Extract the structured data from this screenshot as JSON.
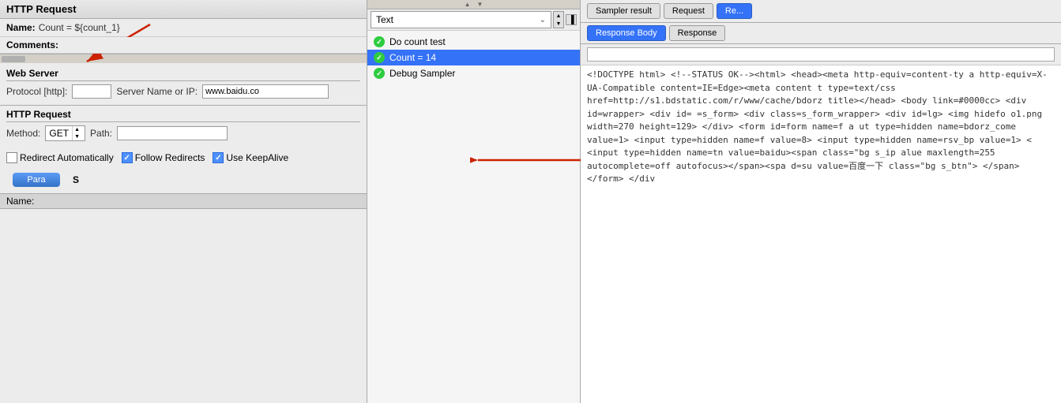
{
  "leftPanel": {
    "title": "HTTP Request",
    "nameLabel": "Name:",
    "nameValue": "Count = ${count_1}",
    "commentsLabel": "Comments:",
    "webServer": {
      "title": "Web Server",
      "protocolLabel": "Protocol [http]:",
      "serverLabel": "Server Name or IP:",
      "serverValue": "www.baidu.co"
    },
    "httpRequest": {
      "title": "HTTP Request",
      "methodLabel": "Method:",
      "methodValue": "GET",
      "pathLabel": "Path:"
    },
    "checkboxes": {
      "redirectAutomatically": "Redirect Automatically",
      "followRedirects": "Follow Redirects",
      "useKeepAlive": "Use KeepAlive"
    },
    "paraButton": "Para",
    "sLabel": "S",
    "nameColumnLabel": "Name:"
  },
  "middlePanel": {
    "dropdownValue": "Text",
    "items": [
      {
        "label": "Do count test",
        "selected": false
      },
      {
        "label": "Count = 14",
        "selected": true
      },
      {
        "label": "Debug Sampler",
        "selected": false
      }
    ]
  },
  "rightPanel": {
    "tabs": [
      {
        "label": "Sampler result",
        "active": false
      },
      {
        "label": "Request",
        "active": false
      },
      {
        "label": "Re...",
        "active": true
      }
    ],
    "responseTabs": [
      {
        "label": "Response Body",
        "active": true
      },
      {
        "label": "Response",
        "active": false
      }
    ],
    "content": "<!DOCTYPE html>\n<!--STATUS OK--><html> <head><meta http-equiv=content-ty\na http-equiv=X-UA-Compatible content=IE=Edge><meta content\nt type=text/css href=http://s1.bdstatic.com/r/www/cache/bdorz\ntitle></head> <body link=#0000cc> <div id=wrapper> <div id=\n=s_form> <div class=s_form_wrapper> <div id=lg> <img hidefo\no1.png width=270 height=129> </div> <form id=form name=f a\nut type=hidden name=bdorz_come value=1> <input type=hidden\n name=f value=8> <input type=hidden name=rsv_bp value=1> <\n<input type=hidden name=tn value=baidu><span class=\"bg s_ip\nalue maxlength=255 autocomplete=off autofocus></span><spa\nd=su value=百度一下 class=\"bg s_btn\"> </span> </form> </div"
  }
}
